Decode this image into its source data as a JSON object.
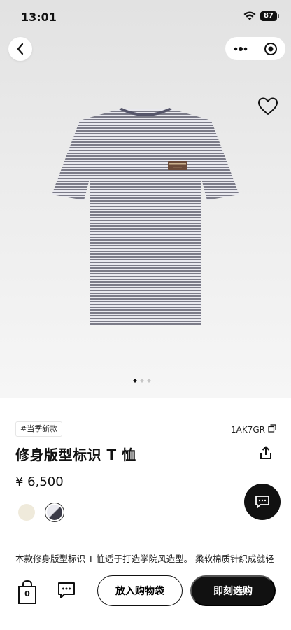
{
  "status_bar": {
    "time": "13:01",
    "battery": "87"
  },
  "nav": {
    "back_icon": "chevron-left-icon",
    "more_icon": "more-dots-icon",
    "mini_program_icon": "target-icon",
    "favorite_icon": "heart-icon"
  },
  "gallery": {
    "image": "striped-tshirt",
    "page_count": 3,
    "active_index": 0
  },
  "product": {
    "tag": "#当季新款",
    "sku": "1AK7GR",
    "title": "修身版型标识 T 恤",
    "price": "¥ 6,500",
    "colors": [
      {
        "name": "beige",
        "hex": "#efeadb",
        "selected": false
      },
      {
        "name": "gray-stripe",
        "hex": "#8e8e98",
        "selected": true
      }
    ],
    "description": "本款修身版型标识 T 恤适于打造学院风造型。 柔软棉质针织成就轻"
  },
  "bottom_bar": {
    "bag_count": "0",
    "add_to_bag_label": "放入购物袋",
    "buy_now_label": "即刻选购"
  },
  "colors": {
    "primary": "#111111",
    "background": "#ffffff",
    "hero_bg": "#e9e9e9"
  }
}
